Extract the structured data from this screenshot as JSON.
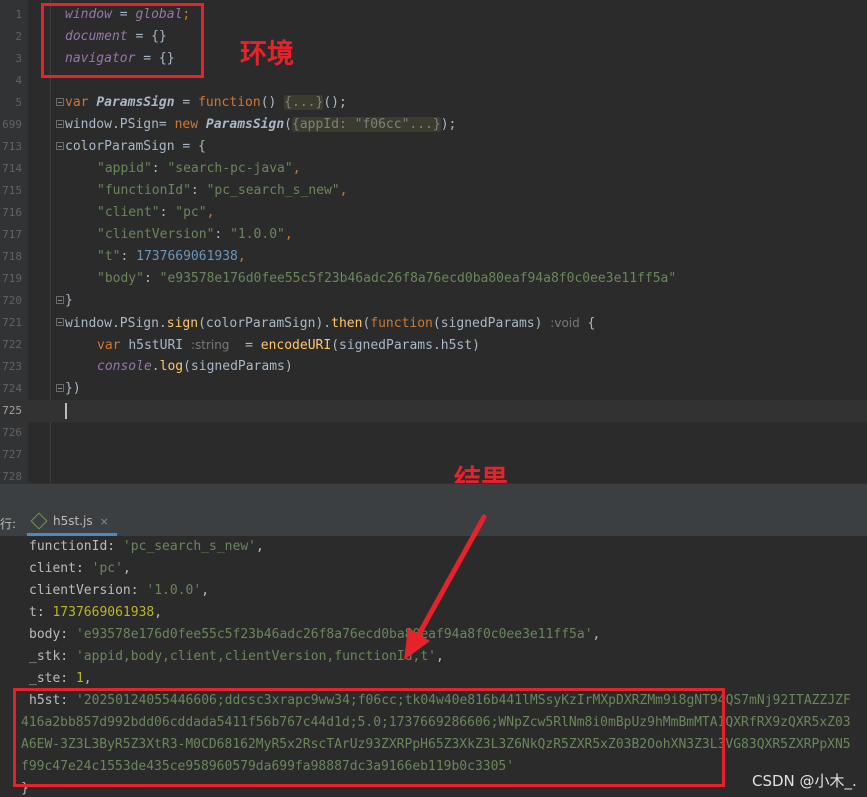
{
  "editor": {
    "lines": [
      {
        "num": "1",
        "segs": [
          [
            "var",
            "window"
          ],
          [
            "plain",
            " = "
          ],
          [
            "var",
            "global"
          ],
          [
            "kw",
            ";"
          ]
        ]
      },
      {
        "num": "2",
        "segs": [
          [
            "var",
            "document"
          ],
          [
            "plain",
            " = {}"
          ]
        ]
      },
      {
        "num": "3",
        "segs": [
          [
            "var",
            "navigator"
          ],
          [
            "plain",
            " = {}"
          ]
        ]
      },
      {
        "num": "4",
        "segs": []
      },
      {
        "num": "5",
        "fold": true,
        "segs": [
          [
            "kw",
            "var "
          ],
          [
            "cls",
            "ParamsSign"
          ],
          [
            "plain",
            " = "
          ],
          [
            "kw",
            "function"
          ],
          [
            "plain",
            "() "
          ],
          [
            "folded",
            "{...}"
          ],
          [
            "plain",
            "();"
          ]
        ]
      },
      {
        "num": "699",
        "fold": true,
        "segs": [
          [
            "plain",
            "window.PSign= "
          ],
          [
            "kw",
            "new "
          ],
          [
            "cls",
            "ParamsSign"
          ],
          [
            "plain",
            "("
          ],
          [
            "folded",
            "{appId: \"f06cc\"...}"
          ],
          [
            "plain",
            ");"
          ]
        ]
      },
      {
        "num": "713",
        "fold": true,
        "segs": [
          [
            "plain",
            "colorParamSign = {"
          ]
        ]
      },
      {
        "num": "714",
        "indent": 1,
        "segs": [
          [
            "str",
            "\"appid\""
          ],
          [
            "plain",
            ": "
          ],
          [
            "str",
            "\"search-pc-java\""
          ],
          [
            "kw",
            ","
          ]
        ]
      },
      {
        "num": "715",
        "indent": 1,
        "segs": [
          [
            "str",
            "\"functionId\""
          ],
          [
            "plain",
            ": "
          ],
          [
            "str",
            "\"pc_search_s_new\""
          ],
          [
            "kw",
            ","
          ]
        ]
      },
      {
        "num": "716",
        "indent": 1,
        "segs": [
          [
            "str",
            "\"client\""
          ],
          [
            "plain",
            ": "
          ],
          [
            "str",
            "\"pc\""
          ],
          [
            "kw",
            ","
          ]
        ]
      },
      {
        "num": "717",
        "indent": 1,
        "segs": [
          [
            "str",
            "\"clientVersion\""
          ],
          [
            "plain",
            ": "
          ],
          [
            "str",
            "\"1.0.0\""
          ],
          [
            "kw",
            ","
          ]
        ]
      },
      {
        "num": "718",
        "indent": 1,
        "segs": [
          [
            "str",
            "\"t\""
          ],
          [
            "plain",
            ": "
          ],
          [
            "num",
            "1737669061938"
          ],
          [
            "kw",
            ","
          ]
        ]
      },
      {
        "num": "719",
        "indent": 1,
        "segs": [
          [
            "str",
            "\"body\""
          ],
          [
            "plain",
            ": "
          ],
          [
            "str",
            "\"e93578e176d0fee55c5f23b46adc26f8a76ecd0ba80eaf94a8f0c0ee3e11ff5a\""
          ]
        ]
      },
      {
        "num": "720",
        "fold": true,
        "segs": [
          [
            "plain",
            "}"
          ]
        ]
      },
      {
        "num": "721",
        "fold": true,
        "segs": [
          [
            "plain",
            "window.PSign."
          ],
          [
            "fn",
            "sign"
          ],
          [
            "plain",
            "(colorParamSign)."
          ],
          [
            "fn",
            "then"
          ],
          [
            "plain",
            "("
          ],
          [
            "kw",
            "function"
          ],
          [
            "plain",
            "(signedParams) "
          ],
          [
            "hint",
            ":void"
          ],
          [
            "plain",
            " {"
          ]
        ]
      },
      {
        "num": "722",
        "indent": 1,
        "segs": [
          [
            "kw",
            "var "
          ],
          [
            "plain",
            "h5stURI "
          ],
          [
            "hint",
            ":string"
          ],
          [
            "plain",
            "  = "
          ],
          [
            "fn",
            "encodeURI"
          ],
          [
            "plain",
            "(signedParams.h5st)"
          ]
        ]
      },
      {
        "num": "723",
        "indent": 1,
        "segs": [
          [
            "var",
            "console"
          ],
          [
            "plain",
            "."
          ],
          [
            "fn",
            "log"
          ],
          [
            "plain",
            "(signedParams)"
          ]
        ]
      },
      {
        "num": "724",
        "fold": true,
        "segs": [
          [
            "plain",
            "})"
          ]
        ]
      },
      {
        "num": "725",
        "current": true,
        "caret": true,
        "segs": []
      },
      {
        "num": "726",
        "segs": []
      },
      {
        "num": "727",
        "segs": []
      },
      {
        "num": "728",
        "segs": []
      }
    ]
  },
  "annotations": {
    "env_label": "环境",
    "result_label": "结果"
  },
  "run_panel": {
    "label": "行:",
    "tab": "h5st.js",
    "close": "×"
  },
  "console": {
    "lines": [
      {
        "segs": [
          [
            "plain",
            "functionId: "
          ],
          [
            "str",
            "'pc_search_s_new'"
          ],
          [
            "plain",
            ","
          ]
        ]
      },
      {
        "segs": [
          [
            "plain",
            "client: "
          ],
          [
            "str",
            "'pc'"
          ],
          [
            "plain",
            ","
          ]
        ]
      },
      {
        "segs": [
          [
            "plain",
            "clientVersion: "
          ],
          [
            "str",
            "'1.0.0'"
          ],
          [
            "plain",
            ","
          ]
        ]
      },
      {
        "segs": [
          [
            "plain",
            "t: "
          ],
          [
            "num",
            "1737669061938"
          ],
          [
            "plain",
            ","
          ]
        ]
      },
      {
        "segs": [
          [
            "plain",
            "body: "
          ],
          [
            "str",
            "'e93578e176d0fee55c5f23b46adc26f8a76ecd0ba80eaf94a8f0c0ee3e11ff5a'"
          ],
          [
            "plain",
            ","
          ]
        ]
      },
      {
        "segs": [
          [
            "plain",
            "_stk: "
          ],
          [
            "str",
            "'appid,body,client,clientVersion,functionId,t'"
          ],
          [
            "plain",
            ","
          ]
        ]
      },
      {
        "segs": [
          [
            "plain",
            "_ste: "
          ],
          [
            "num",
            "1"
          ],
          [
            "plain",
            ","
          ]
        ]
      },
      {
        "segs": [
          [
            "plain",
            "h5st: "
          ],
          [
            "str",
            "'20250124055446606;ddcsc3xrapc9ww34;f06cc;tk04w40e816b441lMSsyKzIrMXpDXRZMm9i8gNT94QS7mNj92ITAZZJZF"
          ]
        ]
      },
      {
        "full": true,
        "segs": [
          [
            "str",
            "416a2bb857d992bdd06cddada5411f56b767c44d1d;5.0;1737669286606;WNpZcw5RlNm8i0mBpUz9hMmBmMTA1QXRfRX9zQXR5xZ03"
          ]
        ]
      },
      {
        "full": true,
        "segs": [
          [
            "str",
            "A6EW-3Z3L3ByR5Z3XtR3-M0CD68162MyR5x2RscTArUz93ZXRPpH65Z3XkZ3L3Z6NkQzR5ZXR5xZ03B2OohXN3Z3L3VG83QXR5ZXRPpXN5"
          ]
        ]
      },
      {
        "full": true,
        "segs": [
          [
            "str",
            "f99c47e24c1553de435ce958960579da699fa98887dc3a9166eb119b0c3305'"
          ]
        ]
      },
      {
        "full": true,
        "segs": [
          [
            "plain",
            "}"
          ]
        ]
      }
    ]
  },
  "watermark": "CSDN @小木_."
}
